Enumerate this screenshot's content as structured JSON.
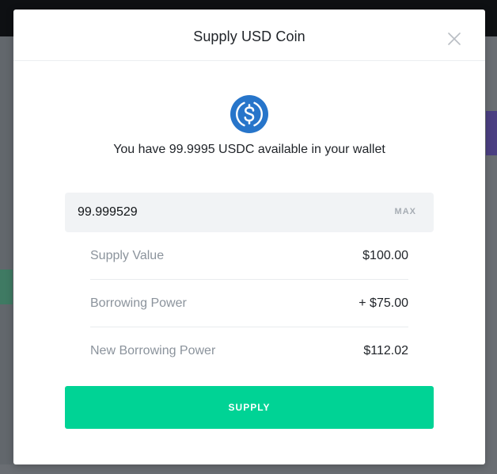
{
  "modal": {
    "title": "Supply USD Coin",
    "close_icon": "close-icon",
    "coin_icon": "usdc-coin-icon",
    "wallet_text": "You have 99.9995 USDC available in your wallet",
    "amount_input": {
      "value": "99.999529"
    },
    "max_label": "MAX",
    "stats": [
      {
        "label": "Supply Value",
        "value": "$100.00"
      },
      {
        "label": "Borrowing Power",
        "value": "+ $75.00"
      },
      {
        "label": "New Borrowing Power",
        "value": "$112.02"
      }
    ],
    "supply_label": "SUPPLY"
  },
  "colors": {
    "accent": "#00d395",
    "usdc_blue": "#2775ca",
    "muted_text": "#8b939c",
    "input_bg": "#f1f3f5"
  }
}
